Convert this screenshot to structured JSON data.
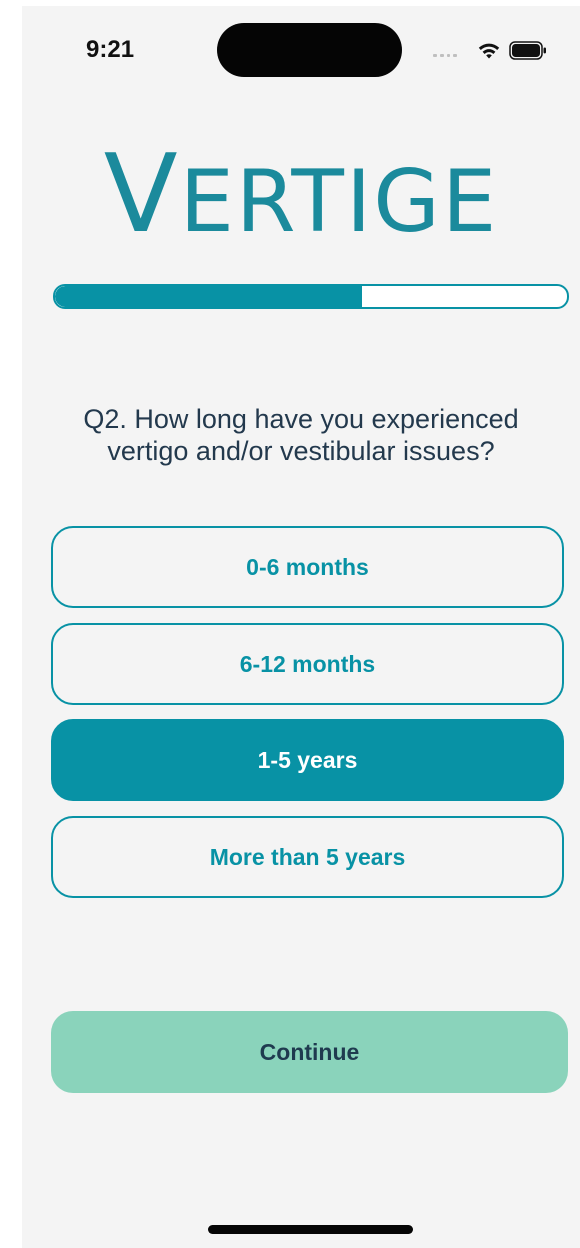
{
  "status_bar": {
    "time": "9:21",
    "icons": [
      "signal-icon",
      "wifi-icon",
      "battery-icon"
    ]
  },
  "logo": {
    "first_letter": "V",
    "rest": "ERTIGE"
  },
  "progress": {
    "fraction": 0.6
  },
  "question": {
    "text": "Q2. How long have you experienced vertigo and/or vestibular issues?"
  },
  "options": [
    {
      "label": "0-6 months",
      "selected": false
    },
    {
      "label": "6-12 months",
      "selected": false
    },
    {
      "label": "1-5 years",
      "selected": true
    },
    {
      "label": "More than 5 years",
      "selected": false
    }
  ],
  "continue_button": {
    "label": "Continue"
  },
  "colors": {
    "accent": "#0892a5",
    "continue_bg": "#8ad3bb",
    "text_dark": "#23394d",
    "background": "#f4f4f4"
  }
}
